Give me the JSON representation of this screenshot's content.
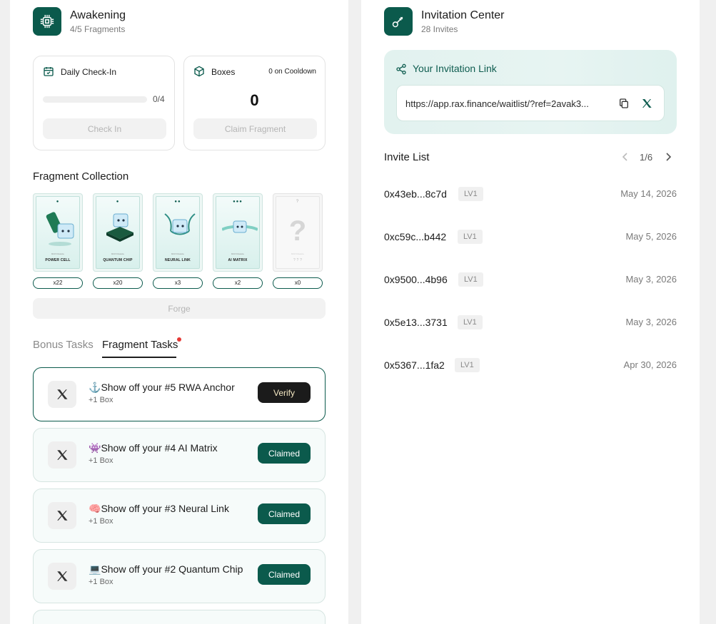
{
  "awakening": {
    "title": "Awakening",
    "subtitle": "4/5 Fragments",
    "checkin": {
      "title": "Daily Check-In",
      "progress_text": "0/4",
      "progress": 0,
      "button": "Check In"
    },
    "boxes": {
      "title": "Boxes",
      "cooldown": "0 on Cooldown",
      "count": "0",
      "button": "Claim Fragment"
    },
    "collection_title": "Fragment Collection",
    "fragments": [
      {
        "name": "POWER CELL",
        "count": "x22",
        "brand": "RAX Finance"
      },
      {
        "name": "QUANTUM CHIP",
        "count": "x20",
        "brand": "RAX Finance"
      },
      {
        "name": "NEURAL LINK",
        "count": "x3",
        "brand": "RAX Finance"
      },
      {
        "name": "AI MATRIX",
        "count": "x2",
        "brand": "RAX Finance"
      },
      {
        "name": "? ? ?",
        "count": "x0",
        "brand": "RAX Finance",
        "mystery": "?",
        "top": "?"
      }
    ],
    "forge_button": "Forge",
    "tabs": {
      "bonus": "Bonus Tasks",
      "fragment": "Fragment Tasks"
    },
    "tasks": [
      {
        "emoji": "⚓",
        "title": "Show off your #5 RWA Anchor",
        "reward": "+1 Box",
        "button": "Verify",
        "state": "verify"
      },
      {
        "emoji": "👾",
        "title": "Show off your #4 AI Matrix",
        "reward": "+1 Box",
        "button": "Claimed",
        "state": "claimed"
      },
      {
        "emoji": "🧠",
        "title": "Show off your #3 Neural Link",
        "reward": "+1 Box",
        "button": "Claimed",
        "state": "claimed"
      },
      {
        "emoji": "💻",
        "title": "Show off your #2 Quantum Chip",
        "reward": "+1 Box",
        "button": "Claimed",
        "state": "claimed"
      }
    ]
  },
  "invitation": {
    "title": "Invitation Center",
    "subtitle": "28 Invites",
    "link_label": "Your Invitation Link",
    "link_url": "https://app.rax.finance/waitlist/?ref=2avak3...",
    "list_title": "Invite List",
    "page": "1/6",
    "invites": [
      {
        "address": "0x43eb...8c7d",
        "level": "LV1",
        "date": "May 14, 2026"
      },
      {
        "address": "0xc59c...b442",
        "level": "LV1",
        "date": "May 5, 2026"
      },
      {
        "address": "0x9500...4b96",
        "level": "LV1",
        "date": "May 3, 2026"
      },
      {
        "address": "0x5e13...3731",
        "level": "LV1",
        "date": "May 3, 2026"
      },
      {
        "address": "0x5367...1fa2",
        "level": "LV1",
        "date": "Apr 30, 2026"
      }
    ]
  },
  "colors": {
    "brand": "#0b5a4c",
    "verify": "#1b1b1b",
    "notify_dot": "#e53935"
  }
}
